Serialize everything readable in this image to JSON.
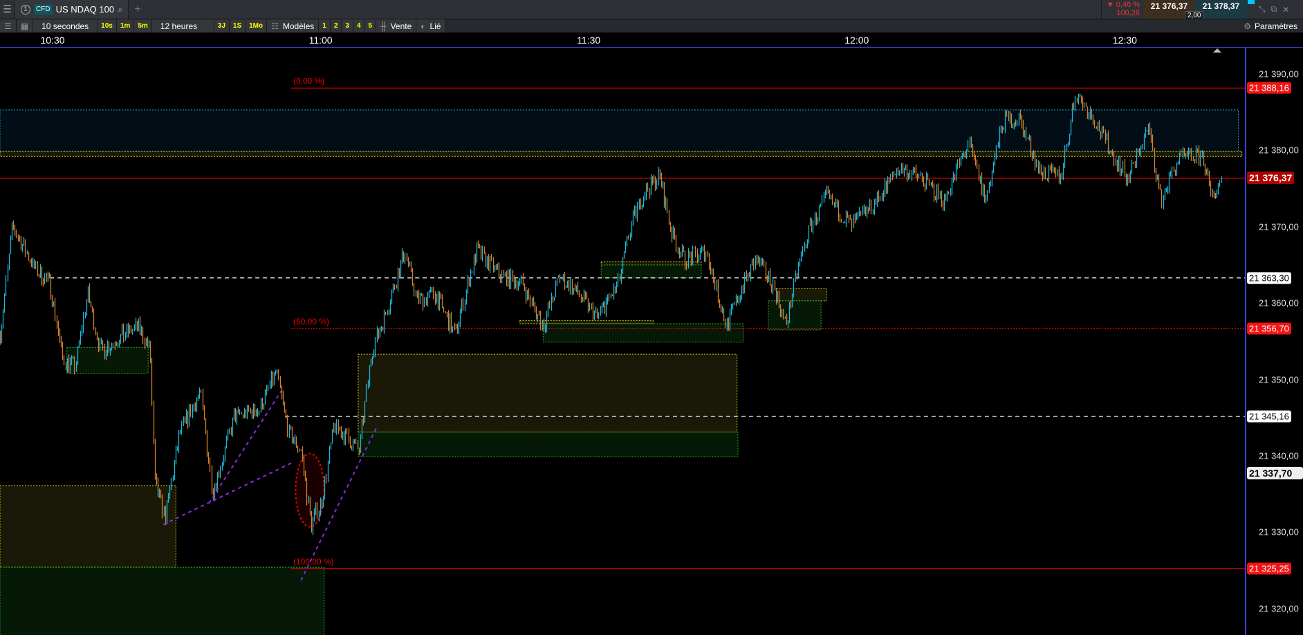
{
  "topbar": {
    "tab_number": "1",
    "instrument_type": "CFD",
    "instrument": "US NDAQ 100",
    "change_pct": "▼ 0,46 %",
    "change_abs": "100,26",
    "bid": "21 376,37",
    "ask": "21 378,37",
    "spread": "2,00"
  },
  "toolbar": {
    "interval": "10 secondes",
    "quick_intervals": [
      "10s",
      "1m",
      "5m"
    ],
    "range": "12 heures",
    "quick_ranges": [
      "3J",
      "1S",
      "1Mo"
    ],
    "templates": "Modèles",
    "layouts": [
      "1",
      "2",
      "3",
      "4",
      "5"
    ],
    "side": "Vente",
    "linked": "Lié",
    "settings": "Paramètres"
  },
  "colors": {
    "up": "#1fb6d8",
    "down": "#d4812c",
    "fib": "#ff1a1a",
    "zone_yellow": "#e6d21a",
    "zone_green": "#22c022",
    "trend": "#8a2be2"
  },
  "chart_data": {
    "type": "ohlc",
    "time_ticks": [
      {
        "label": "10:30",
        "min": 0
      },
      {
        "label": "11:00",
        "min": 30
      },
      {
        "label": "11:30",
        "min": 60
      },
      {
        "label": "12:00",
        "min": 90
      },
      {
        "label": "12:30",
        "min": 120
      }
    ],
    "price_ticks": [
      "21 390,00",
      "21 380,00",
      "21 370,00",
      "21 360,00",
      "21 350,00",
      "21 340,00",
      "21 330,00",
      "21 320,00"
    ],
    "price_tick_values": [
      21390,
      21380,
      21370,
      21360,
      21350,
      21340,
      21330,
      21320
    ],
    "ylim": [
      21314.5,
      21395.5
    ],
    "candle_interval_seconds": 10,
    "price_path": [
      [
        -5.9,
        21355.9
      ],
      [
        -4.5,
        21370.1
      ],
      [
        -2.1,
        21364.7
      ],
      [
        -0.3,
        21362.5
      ],
      [
        1.1,
        21352.7
      ],
      [
        2.5,
        21351.6
      ],
      [
        3.9,
        21361.4
      ],
      [
        5.3,
        21353.8
      ],
      [
        9.5,
        21357.0
      ],
      [
        10.9,
        21353.8
      ],
      [
        11.4,
        21336.4
      ],
      [
        12.6,
        21332.0
      ],
      [
        14.2,
        21342.9
      ],
      [
        16.5,
        21348.3
      ],
      [
        17.9,
        21335.3
      ],
      [
        20.3,
        21345.1
      ],
      [
        23.1,
        21346.1
      ],
      [
        25.0,
        21351.0
      ],
      [
        26.4,
        21342.9
      ],
      [
        27.8,
        21340.7
      ],
      [
        28.9,
        21330.9
      ],
      [
        30.1,
        21334.2
      ],
      [
        31.5,
        21344.0
      ],
      [
        34.3,
        21340.7
      ],
      [
        35.7,
        21353.8
      ],
      [
        37.1,
        21358.1
      ],
      [
        39.4,
        21366.8
      ],
      [
        40.8,
        21360.3
      ],
      [
        42.7,
        21361.4
      ],
      [
        45.0,
        21355.9
      ],
      [
        47.4,
        21366.8
      ],
      [
        50.2,
        21363.6
      ],
      [
        52.5,
        21362.5
      ],
      [
        54.9,
        21357.0
      ],
      [
        56.7,
        21363.6
      ],
      [
        59.5,
        21360.3
      ],
      [
        60.9,
        21358.1
      ],
      [
        63.3,
        21362.5
      ],
      [
        64.7,
        21370.1
      ],
      [
        66.1,
        21374.4
      ],
      [
        67.9,
        21376.6
      ],
      [
        69.3,
        21369.0
      ],
      [
        70.7,
        21365.7
      ],
      [
        73.1,
        21366.8
      ],
      [
        75.4,
        21357.0
      ],
      [
        77.3,
        21362.5
      ],
      [
        78.7,
        21365.7
      ],
      [
        80.6,
        21362.5
      ],
      [
        82.0,
        21357.0
      ],
      [
        83.4,
        21364.6
      ],
      [
        84.8,
        21370.1
      ],
      [
        86.6,
        21373.9
      ],
      [
        89.4,
        21370.1
      ],
      [
        92.2,
        21373.4
      ],
      [
        94.6,
        21377.7
      ],
      [
        96.9,
        21376.6
      ],
      [
        99.7,
        21373.4
      ],
      [
        102.5,
        21381.0
      ],
      [
        104.4,
        21373.4
      ],
      [
        106.3,
        21383.7
      ],
      [
        108.1,
        21384.2
      ],
      [
        110.5,
        21377.2
      ],
      [
        112.8,
        21376.6
      ],
      [
        114.5,
        21387.5
      ],
      [
        116.5,
        21384.2
      ],
      [
        118.4,
        21379.9
      ],
      [
        120.3,
        21376.1
      ],
      [
        122.6,
        21383.1
      ],
      [
        124.0,
        21373.4
      ],
      [
        125.9,
        21378.8
      ],
      [
        128.7,
        21379.3
      ],
      [
        129.6,
        21373.9
      ],
      [
        130.8,
        21376.37
      ]
    ],
    "levels": [
      {
        "price": 21388.16,
        "label": "21 388,16",
        "style": "fib",
        "fib_label": "(0,00 %)",
        "from_min": 26.7
      },
      {
        "price": 21376.37,
        "label": "21 376,37",
        "style": "last"
      },
      {
        "price": 21363.3,
        "label": "21 363,30",
        "style": "dashed-white",
        "from_min": -0.3
      },
      {
        "price": 21356.7,
        "label": "21 356,70",
        "style": "fib-dotted",
        "fib_label": "(50,00 %)",
        "from_min": 26.7
      },
      {
        "price": 21345.16,
        "label": "21 345,16",
        "style": "dashed-white",
        "from_min": 26.0
      },
      {
        "price": 21337.7,
        "label": "21 337,70",
        "style": "cursor"
      },
      {
        "price": 21325.25,
        "label": "21 325,25",
        "style": "fib",
        "fib_label": "(100,00 %)",
        "from_min": 26.7
      }
    ],
    "zones": [
      {
        "kind": "cyan",
        "t0": -6,
        "t1": 132.7,
        "p0": 21385.3,
        "p1": 21379.9
      },
      {
        "kind": "yellow",
        "t0": -6,
        "t1": 133.1,
        "p0": 21379.9,
        "p1": 21379.2
      },
      {
        "kind": "green",
        "t0": 1.6,
        "t1": 10.7,
        "p0": 21354.2,
        "p1": 21350.8
      },
      {
        "kind": "yellow",
        "t0": -6,
        "t1": 13.8,
        "p0": 21336.1,
        "p1": 21325.4
      },
      {
        "kind": "green",
        "t0": -6,
        "t1": 30.4,
        "p0": 21325.4,
        "p1": 21314
      },
      {
        "kind": "yellow",
        "t0": 34.2,
        "t1": 76.6,
        "p0": 21353.3,
        "p1": 21343.1
      },
      {
        "kind": "green",
        "t0": 34.2,
        "t1": 76.7,
        "p0": 21343.1,
        "p1": 21339.9
      },
      {
        "kind": "yellow",
        "t0": 61.4,
        "t1": 72.6,
        "p0": 21365.4,
        "p1": 21365.0
      },
      {
        "kind": "green",
        "t0": 61.4,
        "t1": 72.6,
        "p0": 21365.0,
        "p1": 21363.3
      },
      {
        "kind": "yellow",
        "t0": 52.3,
        "t1": 67.2,
        "p0": 21357.7,
        "p1": 21357.3
      },
      {
        "kind": "green",
        "t0": 54.9,
        "t1": 77.3,
        "p0": 21357.3,
        "p1": 21354.9
      },
      {
        "kind": "yellow",
        "t0": 81.0,
        "t1": 86.6,
        "p0": 21361.9,
        "p1": 21360.3
      },
      {
        "kind": "green",
        "t0": 80.1,
        "t1": 86.0,
        "p0": 21360.3,
        "p1": 21356.5
      }
    ],
    "trendlines": [
      [
        [
          12.4,
          21331.0
        ],
        [
          26.8,
          21339.1
        ]
      ],
      [
        [
          17.5,
          21333.8
        ],
        [
          25.6,
          21348.5
        ]
      ],
      [
        [
          27.8,
          21323.7
        ],
        [
          36.3,
          21343.8
        ]
      ]
    ],
    "ellipse": {
      "center_min": 28.8,
      "center_price": 21335.5,
      "half_width_min": 1.6,
      "half_height": 4.8
    }
  }
}
